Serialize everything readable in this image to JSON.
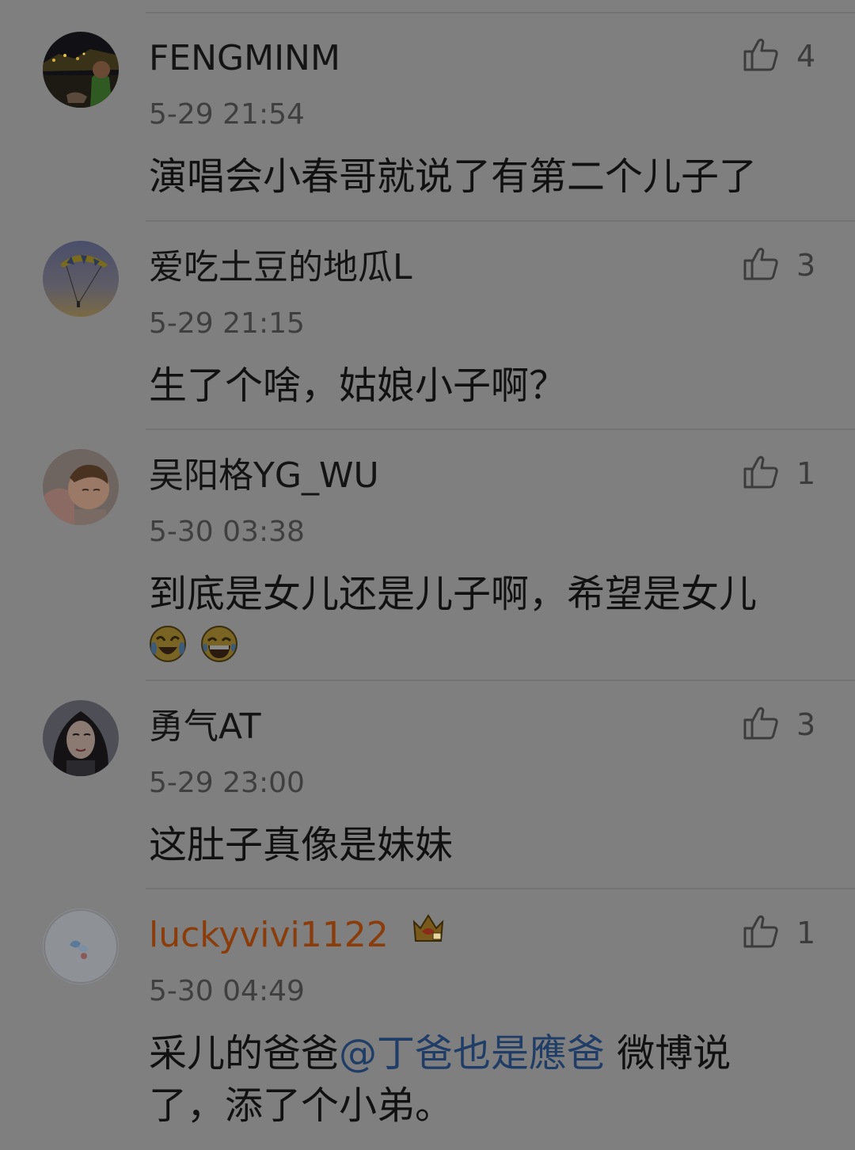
{
  "comments": [
    {
      "username": "FENGMINM",
      "time": "5-29 21:54",
      "likes": "4",
      "text": "演唱会小春哥就说了有第二个儿子了"
    },
    {
      "username": "爱吃土豆的地瓜L",
      "time": "5-29 21:15",
      "likes": "3",
      "text": "生了个啥，姑娘小子啊？"
    },
    {
      "username": "吴阳格YG_WU",
      "time": "5-30 03:38",
      "likes": "1",
      "text": "到底是女儿还是儿子啊，希望是女儿",
      "emojis": [
        "crying-laughing-emoji",
        "laughing-tears-emoji"
      ]
    },
    {
      "username": "勇气AT",
      "time": "5-29 23:00",
      "likes": "3",
      "text": "这肚子真像是妹妹"
    },
    {
      "username": "luckyvivi1122",
      "username_color": "#8a3c0b",
      "badge": "crown-badge-icon",
      "time": "5-30 04:49",
      "likes": "1",
      "text_before": "采儿的爸爸",
      "mention": "@丁爸也是應爸",
      "text_after": " 微博说了，添了个小弟。"
    }
  ],
  "colors": {
    "overlay_background": "#7f7f7f",
    "username": "#141414",
    "vip_username": "#8a3c0b",
    "mention": "#1f3d66"
  }
}
